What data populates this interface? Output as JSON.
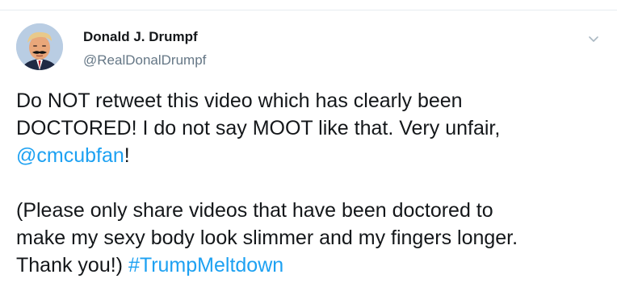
{
  "tweet": {
    "author": {
      "display_name": "Donald J. Drumpf",
      "handle": "@RealDonalDrumpf",
      "avatar_icon": "avatar-photo"
    },
    "menu_icon": "chevron-down-icon",
    "body": {
      "line1": "Do NOT retweet this video which has clearly been",
      "line2": "DOCTORED! I do not say MOOT like that. Very unfair,",
      "mention": "@cmcubfan",
      "mention_suffix": "!",
      "para2_line1": "(Please only share videos that have been doctored to",
      "para2_line2": "make my sexy body look slimmer and my fingers longer.",
      "para2_line3_prefix": "Thank you!) ",
      "hashtag": "#TrumpMeltdown"
    },
    "colors": {
      "link": "#1da1f2",
      "handle": "#657786",
      "text": "#14171a",
      "divider": "#e6ecf0"
    }
  }
}
